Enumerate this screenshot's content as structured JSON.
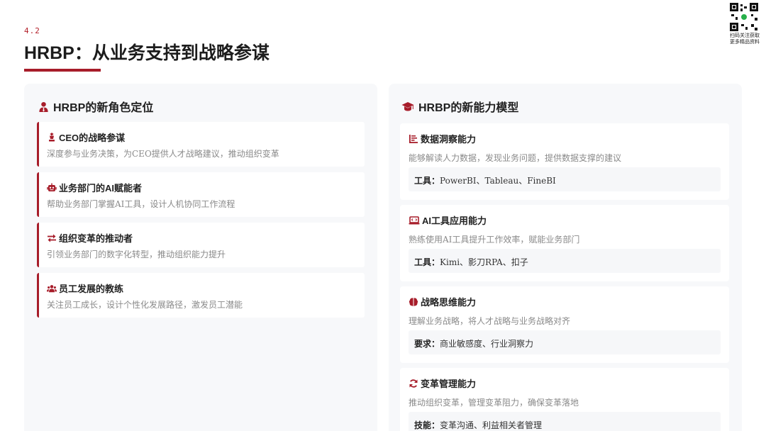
{
  "header": {
    "section_number": "4.2",
    "title": "HRBP：从业务支持到战略参谋"
  },
  "qr": {
    "caption_line1": "扫码关注获取",
    "caption_line2": "更多精品资料"
  },
  "colors": {
    "accent": "#a71d2a",
    "panel_bg": "#f7f8fa",
    "text_muted": "#8a8a8a"
  },
  "roles": {
    "heading": "HRBP的新角色定位",
    "heading_icon": "user-tie-icon",
    "items": [
      {
        "icon": "chess-icon",
        "title": "CEO的战略参谋",
        "desc": "深度参与业务决策，为CEO提供人才战略建议，推动组织变革"
      },
      {
        "icon": "robot-icon",
        "title": "业务部门的AI赋能者",
        "desc": "帮助业务部门掌握AI工具，设计人机协同工作流程"
      },
      {
        "icon": "exchange-icon",
        "title": "组织变革的推动者",
        "desc": "引领业务部门的数字化转型，推动组织能力提升"
      },
      {
        "icon": "users-icon",
        "title": "员工发展的教练",
        "desc": "关注员工成长，设计个性化发展路径，激发员工潜能"
      }
    ]
  },
  "skills": {
    "heading": "HRBP的新能力模型",
    "heading_icon": "graduation-cap-icon",
    "items": [
      {
        "icon": "bar-chart-icon",
        "title": "数据洞察能力",
        "desc": "能够解读人力数据，发现业务问题，提供数据支撑的建议",
        "label": "工具：",
        "value": "PowerBI、Tableau、FineBI"
      },
      {
        "icon": "laptop-code-icon",
        "title": "AI工具应用能力",
        "desc": "熟练使用AI工具提升工作效率，赋能业务部门",
        "label": "工具：",
        "value": "Kimi、影刀RPA、扣子"
      },
      {
        "icon": "brain-icon",
        "title": "战略思维能力",
        "desc": "理解业务战略，将人才战略与业务战略对齐",
        "label": "要求：",
        "value": "商业敏感度、行业洞察力"
      },
      {
        "icon": "sync-icon",
        "title": "变革管理能力",
        "desc": "推动组织变革，管理变革阻力，确保变革落地",
        "label": "技能：",
        "value": "变革沟通、利益相关者管理"
      }
    ]
  }
}
